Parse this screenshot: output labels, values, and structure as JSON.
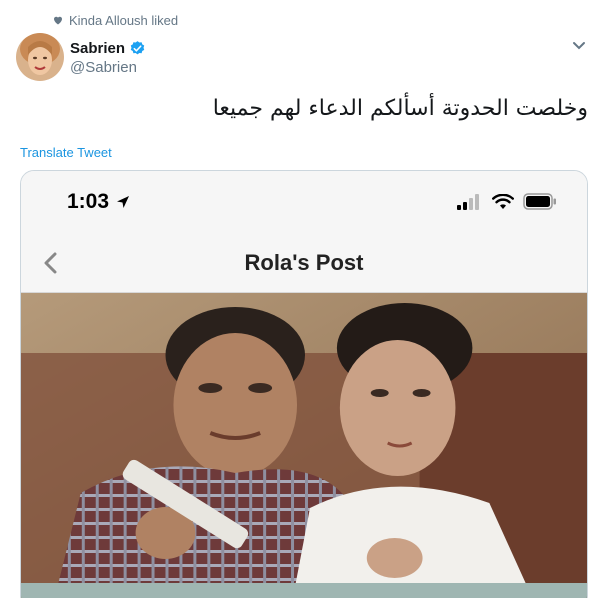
{
  "context": {
    "liked_text": "Kinda Alloush liked"
  },
  "author": {
    "name": "Sabrien",
    "handle": "@Sabrien"
  },
  "tweet": {
    "text": "وخلصت الحدوتة أسألكم الدعاء لهم جميعا",
    "translate_label": "Translate Tweet"
  },
  "media": {
    "status_bar": {
      "time": "1:03"
    },
    "nav_title": "Rola's Post"
  },
  "colors": {
    "link": "#1b95e0",
    "verified": "#1da1f2",
    "muted": "#657786"
  },
  "icons": [
    "heart-icon",
    "verified-badge-icon",
    "chevron-down-icon",
    "location-arrow-icon",
    "signal-icon",
    "wifi-icon",
    "battery-icon",
    "back-chevron-icon"
  ]
}
